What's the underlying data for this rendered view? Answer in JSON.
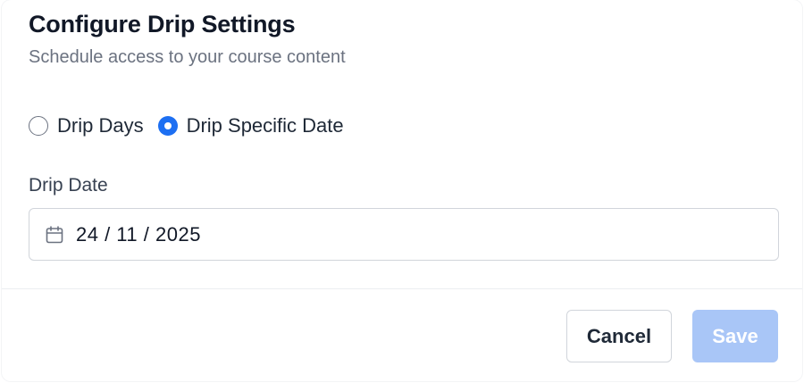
{
  "dialog": {
    "title": "Configure Drip Settings",
    "subtitle": "Schedule access to your course content"
  },
  "drip_type": {
    "options": [
      {
        "label": "Drip Days",
        "checked": false
      },
      {
        "label": "Drip Specific Date",
        "checked": true
      }
    ]
  },
  "drip_date": {
    "label": "Drip Date",
    "value": "24 / 11 / 2025",
    "icon": "calendar-icon"
  },
  "footer": {
    "cancel_label": "Cancel",
    "save_label": "Save",
    "save_disabled": true
  },
  "colors": {
    "accent": "#1d6ff2",
    "save_disabled_bg": "#a9c6f7",
    "title": "#111827",
    "subtitle": "#6b7280"
  }
}
